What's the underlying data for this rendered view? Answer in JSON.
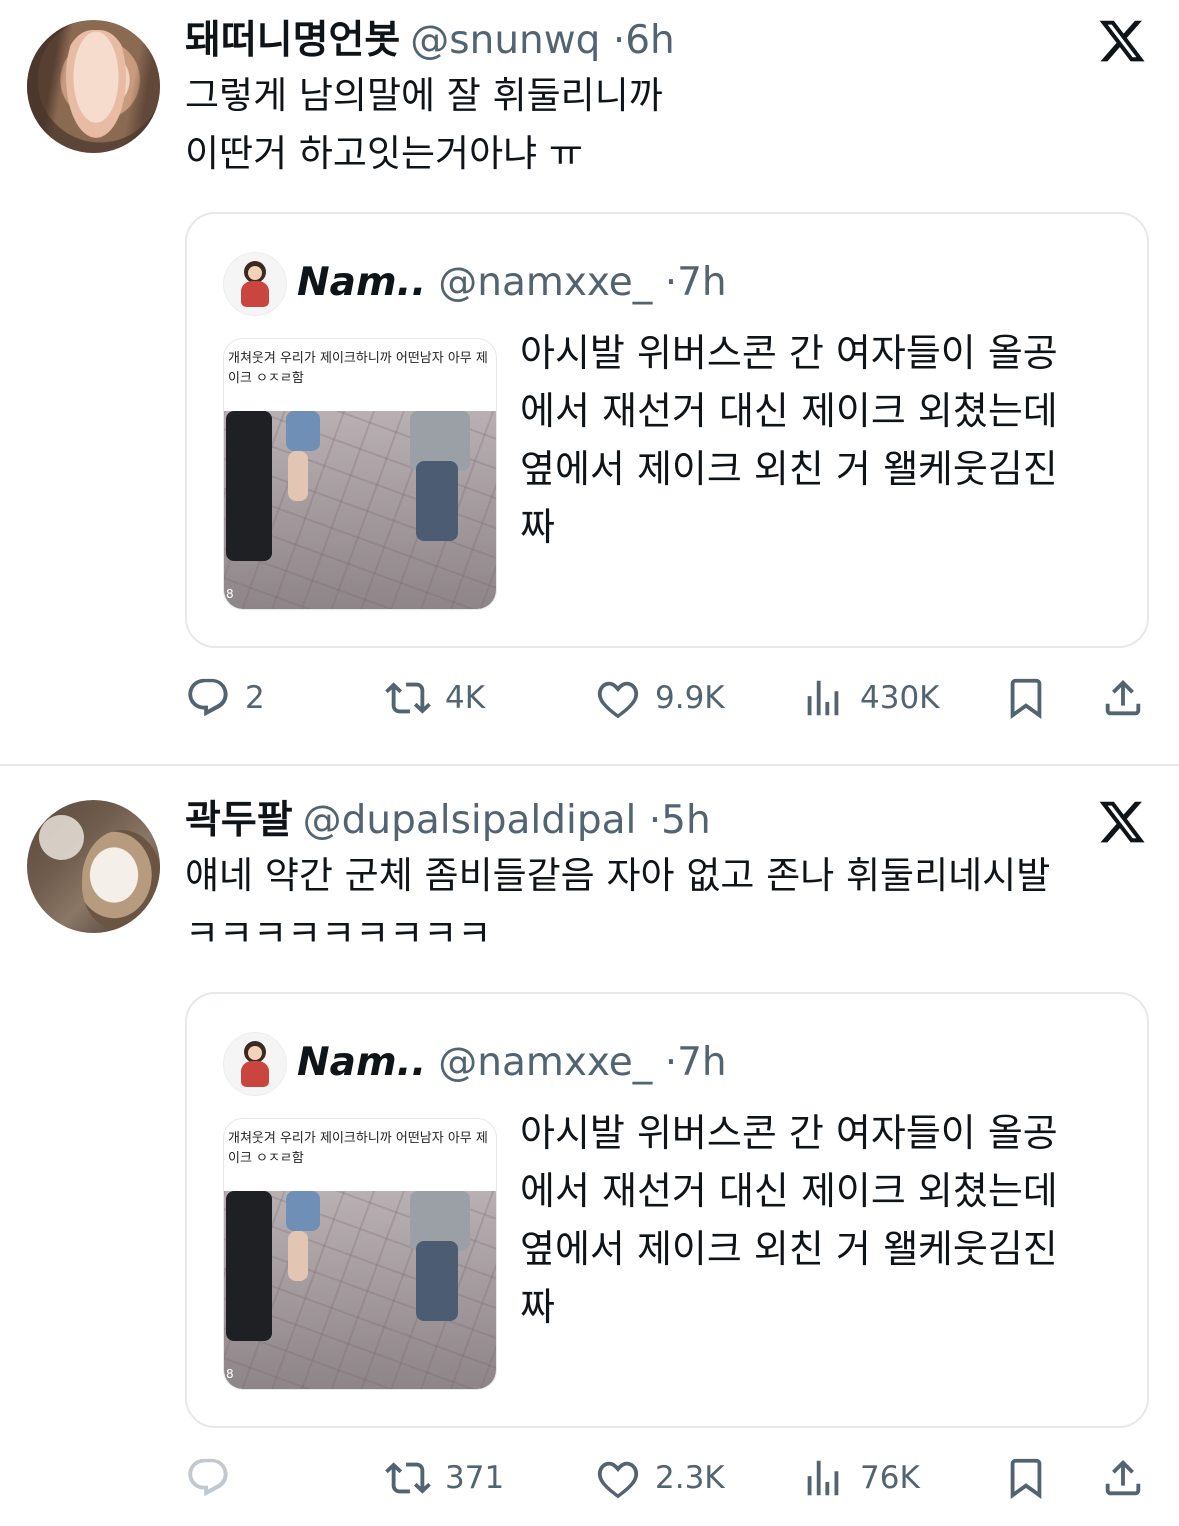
{
  "tweets": [
    {
      "author_name": "돼떠니명언봇",
      "author_handle": "@snunwq",
      "time": "6h",
      "lines": [
        "그렇게 남의말에 잘 휘둘리니까",
        "이딴거 하고잇는거아냐 ㅠ"
      ],
      "quote": {
        "name": "Nam..",
        "handle": "@namxxe_",
        "time": "7h",
        "thumb_caption": "개쳐웃겨 우리가 제이크하니까 어떤남자 아무 제이크 ㅇㅈㄹ함",
        "thumb_counter": "8",
        "lines": [
          "아시발 위버스콘 간 여자들이 올공",
          "에서 재선거 대신 제이크 외쳤는데",
          "옆에서 제이크 외친 거 왤케웃김진",
          "짜"
        ]
      },
      "actions": {
        "replies": "2",
        "retweets": "4K",
        "likes": "9.9K",
        "views": "430K"
      }
    },
    {
      "author_name": "곽두팔",
      "author_handle": "@dupalsipaldipal",
      "time": "5h",
      "lines": [
        "얘네 약간 군체 좀비들같음 자아 없고 존나 휘둘리네시발",
        "ㅋㅋㅋㅋㅋㅋㅋㅋㅋ"
      ],
      "quote": {
        "name": "Nam..",
        "handle": "@namxxe_",
        "time": "7h",
        "thumb_caption": "개쳐웃겨 우리가 제이크하니까 어떤남자 아무 제이크 ㅇㅈㄹ함",
        "thumb_counter": "8",
        "lines": [
          "아시발 위버스콘 간 여자들이 올공",
          "에서 재선거 대신 제이크 외쳤는데",
          "옆에서 제이크 외친 거 왤케웃김진",
          "짜"
        ]
      },
      "actions": {
        "replies": "",
        "retweets": "371",
        "likes": "2.3K",
        "views": "76K"
      }
    }
  ],
  "separator": "·",
  "icons": {
    "logo": "x-logo-icon",
    "reply": "reply-icon",
    "retweet": "retweet-icon",
    "like": "heart-icon",
    "views": "views-icon",
    "bookmark": "bookmark-icon",
    "share": "share-icon"
  },
  "colors": {
    "text": "#0f1419",
    "secondary": "#536471",
    "border": "#e6e9ec"
  }
}
